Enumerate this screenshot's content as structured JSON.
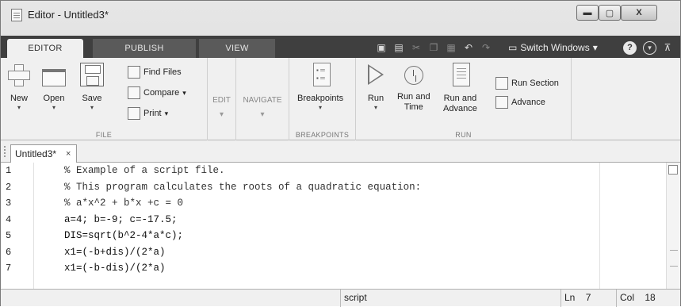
{
  "window": {
    "title": "Editor - Untitled3*",
    "minimize_glyph": "▬",
    "maximize_glyph": "▢",
    "close_glyph": "X"
  },
  "ribbon_tabs": [
    {
      "label": "EDITOR",
      "active": true
    },
    {
      "label": "PUBLISH",
      "active": false
    },
    {
      "label": "VIEW",
      "active": false
    }
  ],
  "toolstrip": {
    "switch_windows_label": "Switch Windows",
    "switch_windows_arrow": "▾",
    "help_glyph": "?",
    "menu_glyph": "▾",
    "pin_glyph": "⊼"
  },
  "groups": {
    "file": {
      "label": "FILE",
      "new_label": "New",
      "open_label": "Open",
      "save_label": "Save",
      "find_files_label": "Find Files",
      "compare_label": "Compare",
      "print_label": "Print",
      "dropdown_glyph": "▾"
    },
    "edit": {
      "label": "EDIT"
    },
    "navigate": {
      "label": "NAVIGATE"
    },
    "breakpoints": {
      "label": "BREAKPOINTS",
      "button_label": "Breakpoints"
    },
    "run": {
      "label": "RUN",
      "run_label": "Run",
      "run_and_time_label": "Run and\nTime",
      "run_and_advance_label": "Run and\nAdvance",
      "run_section_label": "Run Section",
      "advance_label": "Advance"
    }
  },
  "document_tab": {
    "label": "Untitled3*",
    "close_glyph": "×"
  },
  "editor": {
    "lines": [
      {
        "num": "1",
        "text": "% Example of a script file."
      },
      {
        "num": "2",
        "text": "% This program calculates the roots of a quadratic equation:"
      },
      {
        "num": "3",
        "text": "% a*x^2 + b*x +c = 0"
      },
      {
        "num": "4",
        "text": "a=4; b=-9; c=-17.5;"
      },
      {
        "num": "5",
        "text": "DIS=sqrt(b^2-4*a*c);"
      },
      {
        "num": "6",
        "text": "x1=(-b+dis)/(2*a)"
      },
      {
        "num": "7",
        "text": "x1=(-b-dis)/(2*a)"
      }
    ]
  },
  "statusbar": {
    "file_type": "script",
    "line_label": "Ln",
    "line_value": "7",
    "col_label": "Col",
    "col_value": "18"
  }
}
